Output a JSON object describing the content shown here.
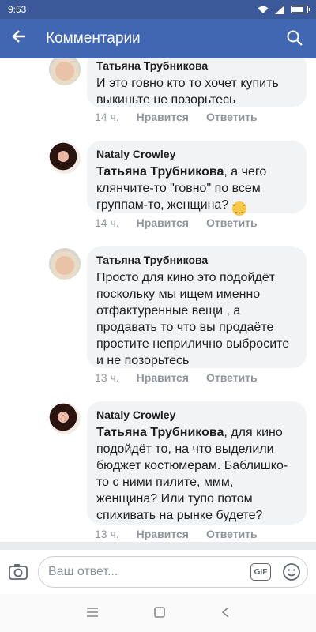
{
  "status_bar": {
    "time": "9:53"
  },
  "header": {
    "title": "Комментарии"
  },
  "comments": [
    {
      "author": "Татьяна Трубникова",
      "text": "И это говно кто то хочет купить выкиньте не позорьтесь",
      "time": "14 ч.",
      "like": "Нравится",
      "reply": "Ответить"
    },
    {
      "author": "Nataly Crowley",
      "mention": "Татьяна Трубникова",
      "text": ", а чего клянчите-то \"говно\" по всем группам-то, женщина?",
      "emoji": "grinning-sweat-emoji",
      "time": "14 ч.",
      "like": "Нравится",
      "reply": "Ответить"
    },
    {
      "author": "Татьяна Трубникова",
      "text": "Просто для кино это подойдёт поскольку мы ищем именно отфактуренные вещи , а продавать то что вы продаёте простите неприлично выбросите и не позорьтесь",
      "time": "13 ч.",
      "like": "Нравится",
      "reply": "Ответить"
    },
    {
      "author": "Nataly Crowley",
      "mention": "Татьяна Трубникова",
      "text": ", для кино подойдёт то, на что выделили бюджет костюмерам. Баблишко-то с ними пилите, ммм, женщина? Или тупо потом спихивать на рынке будете?",
      "time": "13 ч.",
      "like": "Нравится",
      "reply": "Ответить"
    }
  ],
  "composer": {
    "placeholder": "Ваш ответ...",
    "gif_label": "GIF"
  },
  "colors": {
    "header": "#4267b2",
    "status_bar": "#3b5998",
    "bubble": "#f2f3f5",
    "meta": "#90949c"
  }
}
